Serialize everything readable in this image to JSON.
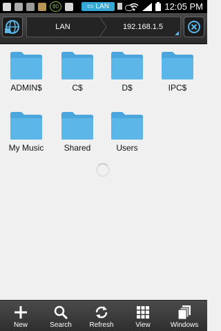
{
  "status_bar": {
    "time": "12:05 PM",
    "tab_label": "LAN",
    "badge": "80"
  },
  "toolbar": {
    "breadcrumbs": [
      "LAN",
      "192.168.1.5"
    ]
  },
  "folders": [
    {
      "name": "ADMIN$"
    },
    {
      "name": "C$"
    },
    {
      "name": "D$"
    },
    {
      "name": "IPC$"
    },
    {
      "name": "My Music"
    },
    {
      "name": "Shared"
    },
    {
      "name": "Users"
    }
  ],
  "bottom_bar": {
    "new_label": "New",
    "search_label": "Search",
    "refresh_label": "Refresh",
    "view_label": "View",
    "windows_label": "Windows"
  },
  "colors": {
    "folder_blue": "#5cb6e8",
    "accent": "#35a8d6"
  }
}
